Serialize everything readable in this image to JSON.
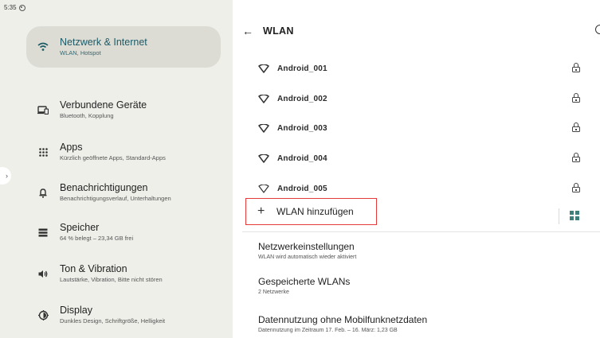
{
  "status_bar": {
    "time": "5:35"
  },
  "sidebar": {
    "items": [
      {
        "title": "Netzwerk & Internet",
        "subtitle": "WLAN, Hotspot",
        "icon": "wifi-icon",
        "active": true
      },
      {
        "title": "Verbundene Geräte",
        "subtitle": "Bluetooth, Kopplung",
        "icon": "devices-icon",
        "active": false
      },
      {
        "title": "Apps",
        "subtitle": "Kürzlich geöffnete Apps, Standard-Apps",
        "icon": "apps-grid-icon",
        "active": false
      },
      {
        "title": "Benachrichtigungen",
        "subtitle": "Benachrichtigungsverlauf, Unterhaltungen",
        "icon": "bell-icon",
        "active": false
      },
      {
        "title": "Speicher",
        "subtitle": "64 % belegt – 23,34 GB frei",
        "icon": "storage-icon",
        "active": false
      },
      {
        "title": "Ton & Vibration",
        "subtitle": "Lautstärke, Vibration, Bitte nicht stören",
        "icon": "volume-icon",
        "active": false
      },
      {
        "title": "Display",
        "subtitle": "Dunkles Design, Schriftgröße, Helligkeit",
        "icon": "display-icon",
        "active": false
      }
    ]
  },
  "header": {
    "title": "WLAN"
  },
  "networks": [
    {
      "ssid": "Android_001",
      "secured": true
    },
    {
      "ssid": "Android_002",
      "secured": true
    },
    {
      "ssid": "Android_003",
      "secured": true
    },
    {
      "ssid": "Android_004",
      "secured": true
    },
    {
      "ssid": "Android_005",
      "secured": true
    }
  ],
  "add_network": {
    "label": "WLAN hinzufügen"
  },
  "settings": [
    {
      "title": "Netzwerkeinstellungen",
      "subtitle": "WLAN wird automatisch wieder aktiviert"
    },
    {
      "title": "Gespeicherte WLANs",
      "subtitle": "2 Netzwerke"
    },
    {
      "title": "Datennutzung ohne Mobilfunknetzdaten",
      "subtitle": "Datennutzung im Zeitraum 17. Feb. – 16. März: 1,23 GB"
    }
  ],
  "colors": {
    "accent": "#1d5a66",
    "highlight_border": "#e43a3a",
    "sidebar_bg": "#efefea",
    "active_bg": "#dcdcd5"
  }
}
